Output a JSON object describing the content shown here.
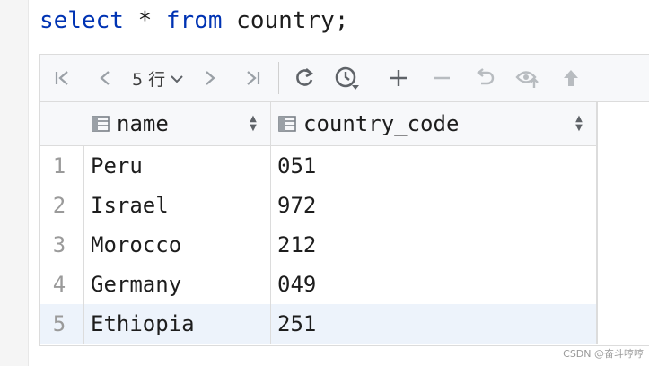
{
  "editor": {
    "keyword_select": "select",
    "star": " * ",
    "keyword_from": "from",
    "rest": " country;"
  },
  "toolbar": {
    "first_icon": "first-page-icon",
    "prev_icon": "previous-page-icon",
    "rows_label": "5 行",
    "next_icon": "next-page-icon",
    "last_icon": "last-page-icon",
    "refresh_icon": "refresh-icon",
    "history_icon": "history-icon",
    "add_icon": "add-row-icon",
    "remove_icon": "remove-row-icon",
    "revert_icon": "revert-icon",
    "preview_icon": "preview-icon",
    "submit_icon": "submit-icon"
  },
  "table": {
    "columns": [
      {
        "name": "name",
        "icon": "column-icon"
      },
      {
        "name": "country_code",
        "icon": "column-icon"
      }
    ],
    "rows": [
      {
        "num": "1",
        "name": "Peru",
        "country_code": "051"
      },
      {
        "num": "2",
        "name": "Israel",
        "country_code": "972"
      },
      {
        "num": "3",
        "name": "Morocco",
        "country_code": "212"
      },
      {
        "num": "4",
        "name": "Germany",
        "country_code": "049"
      },
      {
        "num": "5",
        "name": "Ethiopia",
        "country_code": "251"
      }
    ],
    "selected_row": "5"
  },
  "watermark": "CSDN @奋斗哼哼"
}
